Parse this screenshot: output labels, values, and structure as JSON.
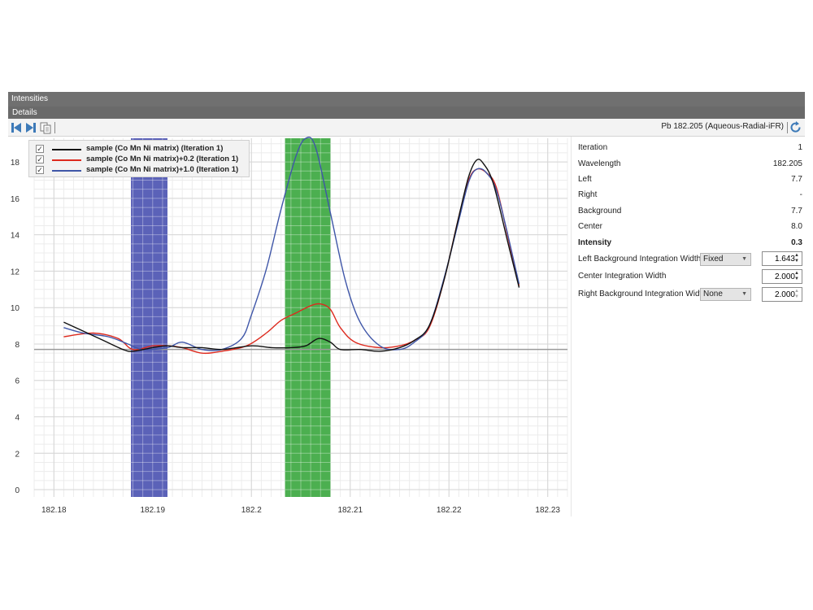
{
  "window": {
    "title": "Intensities",
    "subtitle": "Details"
  },
  "toolbar": {
    "element_label": "Pb 182.205 (Aqueous-Radial-iFR)"
  },
  "colors": {
    "accent": "#3d7ab8",
    "left_background_band": "#5b62b8",
    "center_band": "#4caf50",
    "baseline": "#9a9a9a"
  },
  "legend": [
    {
      "label": "sample (Co Mn Ni matrix) (Iteration 1)",
      "color": "#111111",
      "checked": true
    },
    {
      "label": "sample (Co Mn Ni matrix)+0.2 (Iteration 1)",
      "color": "#dd2a1e",
      "checked": true
    },
    {
      "label": "sample (Co Mn Ni matrix)+1.0 (Iteration 1)",
      "color": "#3f56a8",
      "checked": true
    }
  ],
  "properties": {
    "iteration": {
      "label": "Iteration",
      "value": "1"
    },
    "wavelength": {
      "label": "Wavelength",
      "value": "182.205"
    },
    "left": {
      "label": "Left",
      "value": "7.7"
    },
    "right": {
      "label": "Right",
      "value": "-"
    },
    "background": {
      "label": "Background",
      "value": "7.7"
    },
    "center": {
      "label": "Center",
      "value": "8.0"
    },
    "intensity": {
      "label": "Intensity",
      "value": "0.3"
    },
    "left_bg_width": {
      "label": "Left Background Integration Width",
      "mode": "Fixed",
      "value": "1.643"
    },
    "center_width": {
      "label": "Center Integration Width",
      "value": "2.000"
    },
    "right_bg_width": {
      "label": "Right Background Integration Width",
      "mode": "None",
      "value": "2.000"
    }
  },
  "chart_data": {
    "type": "line",
    "xlim": [
      182.178,
      182.232
    ],
    "ylim": [
      -0.4,
      19.3
    ],
    "x_ticks": [
      182.18,
      182.19,
      182.2,
      182.21,
      182.22,
      182.23
    ],
    "x_tick_labels": [
      "182.18",
      "182.19",
      "182.2",
      "182.21",
      "182.22",
      "182.23"
    ],
    "y_ticks": [
      0,
      2,
      4,
      6,
      8,
      10,
      12,
      14,
      16,
      18
    ],
    "y_tick_labels": [
      "0",
      "2",
      "4",
      "6",
      "8",
      "10",
      "12",
      "14",
      "16",
      "18"
    ],
    "grid": true,
    "legend_position": "top-left",
    "baseline": 7.7,
    "bands": [
      {
        "x0": 182.1878,
        "x1": 182.1915,
        "color": "#5b62b8"
      },
      {
        "x0": 182.2034,
        "x1": 182.208,
        "color": "#4caf50"
      }
    ],
    "series": [
      {
        "name": "sample (Co Mn Ni matrix) (Iteration 1)",
        "color": "#111111",
        "points": [
          [
            182.181,
            9.2
          ],
          [
            182.183,
            8.7
          ],
          [
            182.185,
            8.2
          ],
          [
            182.187,
            7.7
          ],
          [
            182.188,
            7.6
          ],
          [
            182.19,
            7.8
          ],
          [
            182.1915,
            7.9
          ],
          [
            182.193,
            7.8
          ],
          [
            182.195,
            7.8
          ],
          [
            182.197,
            7.7
          ],
          [
            182.2,
            7.9
          ],
          [
            182.202,
            7.8
          ],
          [
            182.204,
            7.8
          ],
          [
            182.2055,
            7.9
          ],
          [
            182.2068,
            8.3
          ],
          [
            182.208,
            8.1
          ],
          [
            182.209,
            7.7
          ],
          [
            182.211,
            7.7
          ],
          [
            182.213,
            7.6
          ],
          [
            182.215,
            7.8
          ],
          [
            182.2165,
            8.2
          ],
          [
            182.218,
            9.0
          ],
          [
            182.2195,
            11.5
          ],
          [
            182.221,
            15.0
          ],
          [
            182.222,
            17.2
          ],
          [
            182.2228,
            18.1
          ],
          [
            182.2235,
            17.9
          ],
          [
            182.2245,
            16.8
          ],
          [
            182.226,
            13.5
          ],
          [
            182.2271,
            11.1
          ]
        ]
      },
      {
        "name": "sample (Co Mn Ni matrix)+0.2 (Iteration 1)",
        "color": "#dd2a1e",
        "points": [
          [
            182.181,
            8.4
          ],
          [
            182.184,
            8.6
          ],
          [
            182.1865,
            8.3
          ],
          [
            182.188,
            7.7
          ],
          [
            182.19,
            7.9
          ],
          [
            182.1915,
            7.9
          ],
          [
            182.193,
            7.8
          ],
          [
            182.195,
            7.5
          ],
          [
            182.197,
            7.6
          ],
          [
            182.1995,
            7.9
          ],
          [
            182.2015,
            8.6
          ],
          [
            182.203,
            9.3
          ],
          [
            182.2045,
            9.7
          ],
          [
            182.206,
            10.1
          ],
          [
            182.207,
            10.2
          ],
          [
            182.208,
            9.9
          ],
          [
            182.209,
            8.9
          ],
          [
            182.2105,
            8.1
          ],
          [
            182.213,
            7.8
          ],
          [
            182.215,
            7.9
          ],
          [
            182.2165,
            8.2
          ],
          [
            182.218,
            8.9
          ],
          [
            182.2195,
            11.5
          ],
          [
            182.221,
            15.0
          ],
          [
            182.222,
            17.0
          ],
          [
            182.2228,
            17.6
          ],
          [
            182.2238,
            17.4
          ],
          [
            182.2248,
            16.6
          ],
          [
            182.226,
            13.8
          ],
          [
            182.2271,
            11.2
          ]
        ]
      },
      {
        "name": "sample (Co Mn Ni matrix)+1.0 (Iteration 1)",
        "color": "#3f56a8",
        "points": [
          [
            182.181,
            8.9
          ],
          [
            182.183,
            8.6
          ],
          [
            182.1855,
            8.4
          ],
          [
            182.1875,
            8.0
          ],
          [
            182.189,
            7.7
          ],
          [
            182.1915,
            7.8
          ],
          [
            182.193,
            8.1
          ],
          [
            182.195,
            7.7
          ],
          [
            182.197,
            7.7
          ],
          [
            182.199,
            8.3
          ],
          [
            182.2,
            9.6
          ],
          [
            182.2015,
            12.1
          ],
          [
            182.203,
            15.4
          ],
          [
            182.2045,
            18.3
          ],
          [
            182.2055,
            19.3
          ],
          [
            182.2065,
            18.8
          ],
          [
            182.208,
            15.2
          ],
          [
            182.2095,
            11.5
          ],
          [
            182.211,
            9.2
          ],
          [
            182.213,
            7.9
          ],
          [
            182.215,
            7.7
          ],
          [
            182.2165,
            8.1
          ],
          [
            182.218,
            9.0
          ],
          [
            182.2195,
            11.6
          ],
          [
            182.221,
            14.8
          ],
          [
            182.222,
            16.9
          ],
          [
            182.2228,
            17.6
          ],
          [
            182.2238,
            17.4
          ],
          [
            182.225,
            16.1
          ],
          [
            182.2271,
            11.3
          ]
        ]
      }
    ]
  }
}
